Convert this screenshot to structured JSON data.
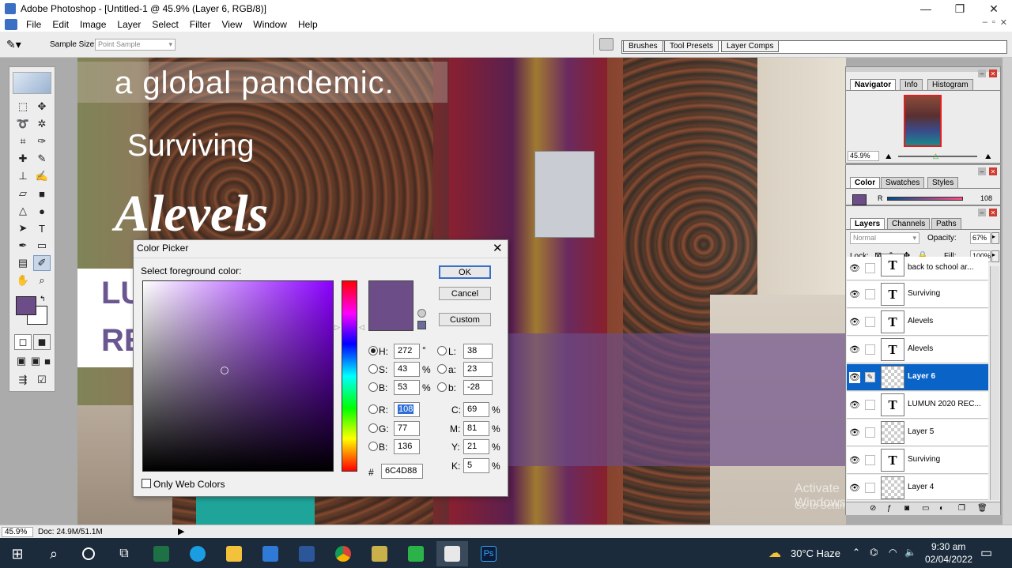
{
  "window": {
    "title": "Adobe Photoshop - [Untitled-1 @ 45.9% (Layer 6, RGB/8)]",
    "min": "—",
    "restore": "❐",
    "close": "✕"
  },
  "menu": [
    "File",
    "Edit",
    "Image",
    "Layer",
    "Select",
    "Filter",
    "View",
    "Window",
    "Help"
  ],
  "mdi_controls": [
    "–",
    "▫",
    "✕"
  ],
  "options": {
    "sample_size_label": "Sample Size:",
    "sample_size_value": "Point Sample"
  },
  "palette_well": [
    "Brushes",
    "Tool Presets",
    "Layer Comps"
  ],
  "canvas": {
    "line1": "a global pandemic.",
    "line2": "Surviving",
    "line3": "Alevels",
    "line4a": "LU",
    "line4b": "RE",
    "watermark1": "Activate Windows",
    "watermark2": "Go to Settings to activate Windows."
  },
  "navigator": {
    "tabs": [
      "Navigator",
      "Info",
      "Histogram"
    ],
    "zoom": "45.9%"
  },
  "color_panel": {
    "tabs": [
      "Color",
      "Swatches",
      "Styles"
    ],
    "channel": "R",
    "value": "108"
  },
  "layers_panel": {
    "tabs": [
      "Layers",
      "Channels",
      "Paths"
    ],
    "blend_mode": "Normal",
    "opacity_label": "Opacity:",
    "opacity_value": "67%",
    "lock_label": "Lock:",
    "fill_label": "Fill:",
    "fill_value": "100%",
    "layers": [
      {
        "name": "back to school ar...",
        "kind": "text"
      },
      {
        "name": "Surviving",
        "kind": "text"
      },
      {
        "name": "Alevels",
        "kind": "text"
      },
      {
        "name": "Alevels",
        "kind": "text"
      },
      {
        "name": "Layer 6",
        "kind": "raster",
        "selected": true
      },
      {
        "name": "LUMUN 2020 REC...",
        "kind": "text"
      },
      {
        "name": "Layer 5",
        "kind": "raster"
      },
      {
        "name": "Surviving",
        "kind": "text"
      },
      {
        "name": "Layer 4",
        "kind": "raster"
      }
    ]
  },
  "status": {
    "zoom": "45.9%",
    "doc": "Doc: 24.9M/51.1M"
  },
  "color_picker": {
    "title": "Color Picker",
    "prompt": "Select foreground color:",
    "ok": "OK",
    "cancel": "Cancel",
    "custom": "Custom",
    "hsb": {
      "H_label": "H:",
      "H": "272",
      "H_unit": "°",
      "S_label": "S:",
      "S": "43",
      "S_unit": "%",
      "B_label": "B:",
      "B": "53",
      "B_unit": "%"
    },
    "rgb": {
      "R_label": "R:",
      "R": "108",
      "G_label": "G:",
      "G": "77",
      "B_label": "B:",
      "B": "136"
    },
    "lab": {
      "L_label": "L:",
      "L": "38",
      "a_label": "a:",
      "a": "23",
      "b_label": "b:",
      "b": "-28"
    },
    "cmyk": {
      "C_label": "C:",
      "C": "69",
      "M_label": "M:",
      "M": "81",
      "Y_label": "Y:",
      "Y": "21",
      "K_label": "K:",
      "K": "5",
      "unit": "%"
    },
    "hex_label": "#",
    "hex": "6C4D88",
    "web_colors": "Only Web Colors",
    "selected_color": "#6C4D88"
  },
  "taskbar": {
    "weather": "30°C  Haze",
    "time": "9:30 am",
    "date": "02/04/2022"
  }
}
